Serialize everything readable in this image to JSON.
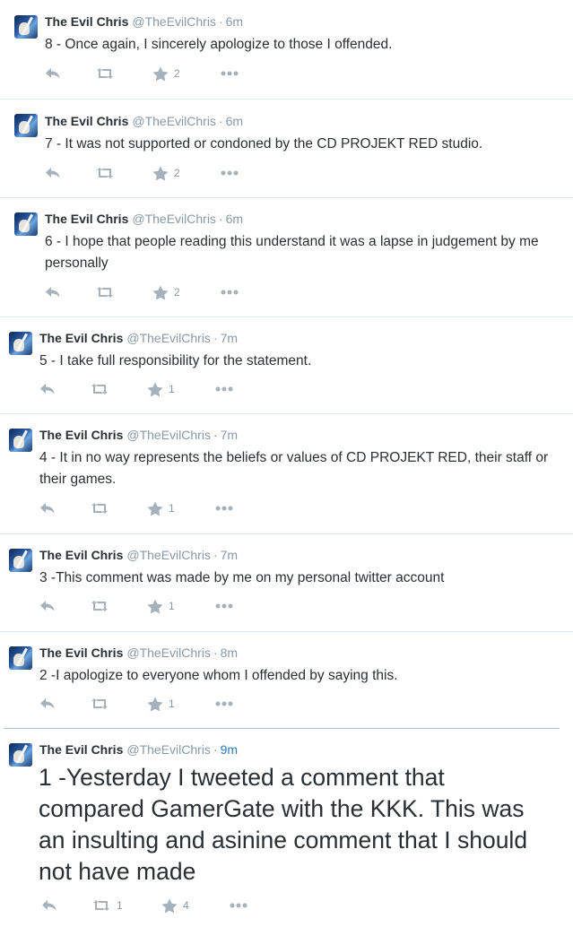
{
  "tweets": [
    {
      "name": "The Evil Chris",
      "handle": "@TheEvilChris",
      "time": "6m",
      "text": "8 - Once again, I sincerely apologize to those I offended.",
      "favorites": "2",
      "retweets": ""
    },
    {
      "name": "The Evil Chris",
      "handle": "@TheEvilChris",
      "time": "6m",
      "text": "7 -  It was not supported or condoned by the CD PROJEKT RED studio.",
      "favorites": "2",
      "retweets": ""
    },
    {
      "name": "The Evil Chris",
      "handle": "@TheEvilChris",
      "time": "6m",
      "text": "6 - I hope that people reading this understand it was a lapse in judgement by me personally",
      "favorites": "2",
      "retweets": ""
    },
    {
      "name": "The Evil Chris",
      "handle": "@TheEvilChris",
      "time": "7m",
      "text": "5 - I take full responsibility for the statement.",
      "favorites": "1",
      "retweets": ""
    },
    {
      "name": "The Evil Chris",
      "handle": "@TheEvilChris",
      "time": "7m",
      "text": "4 - It in no way represents the beliefs or values of CD PROJEKT RED, their staff or their games.",
      "favorites": "1",
      "retweets": ""
    },
    {
      "name": "The Evil Chris",
      "handle": "@TheEvilChris",
      "time": "7m",
      "text": "3 -This comment was made by me on my personal twitter account",
      "favorites": "1",
      "retweets": ""
    },
    {
      "name": "The Evil Chris",
      "handle": "@TheEvilChris",
      "time": "8m",
      "text": "2 -I apologize to everyone whom I offended by saying this.",
      "favorites": "1",
      "retweets": ""
    },
    {
      "name": "The Evil Chris",
      "handle": "@TheEvilChris",
      "time": "9m",
      "text": "1 -Yesterday I tweeted a comment that compared GamerGate with the KKK. This was an insulting and asinine comment that I should not have made",
      "favorites": "4",
      "retweets": "1"
    }
  ],
  "meta": {
    "time_separator": "·"
  },
  "icons": {
    "reply": "reply-icon",
    "retweet": "retweet-icon",
    "favorite": "star-icon",
    "more": "more-icon"
  },
  "colors": {
    "link": "#2b7bb9",
    "muted": "#8899a6",
    "icon": "#a5b2bc",
    "divider": "#e1e8ed"
  }
}
